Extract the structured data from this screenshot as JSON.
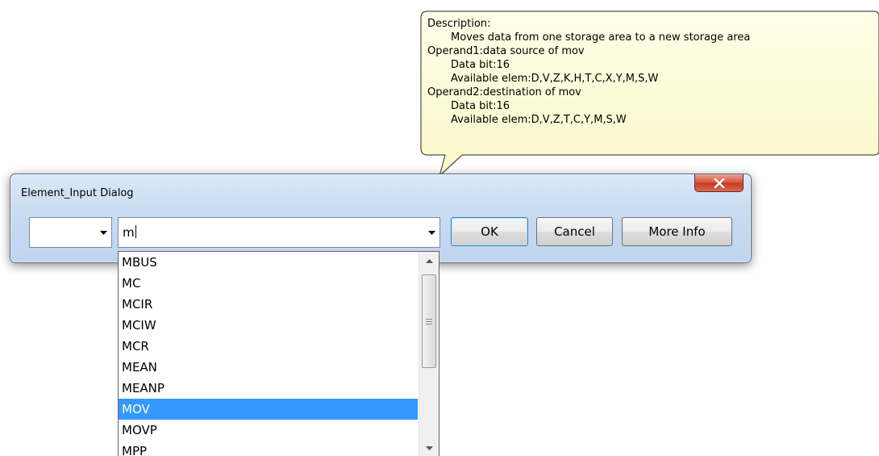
{
  "tooltip": {
    "lines": [
      {
        "text": "Description:",
        "indent": false
      },
      {
        "text": "Moves data from one storage area to a new storage area",
        "indent": true
      },
      {
        "text": "Operand1:data source of mov",
        "indent": false
      },
      {
        "text": "Data bit:16",
        "indent": true
      },
      {
        "text": "Available elem:D,V,Z,K,H,T,C,X,Y,M,S,W",
        "indent": true
      },
      {
        "text": "Operand2:destination of mov",
        "indent": false
      },
      {
        "text": "Data bit:16",
        "indent": true
      },
      {
        "text": "Available elem:D,V,Z,T,C,Y,M,S,W",
        "indent": true
      }
    ],
    "background_color": "#ffffe1"
  },
  "dialog": {
    "title": "Element_Input Dialog",
    "close_icon": "close-x-icon",
    "prefix_select": {
      "value": ""
    },
    "instruction_input": {
      "value": "m"
    },
    "buttons": {
      "ok": "OK",
      "cancel": "Cancel",
      "more_info": "More Info"
    }
  },
  "dropdown": {
    "items": [
      "MBUS",
      "MC",
      "MCIR",
      "MCIW",
      "MCR",
      "MEAN",
      "MEANP",
      "MOV",
      "MOVP",
      "MPP"
    ],
    "selected": "MOV",
    "selection_color": "#3399ff"
  }
}
